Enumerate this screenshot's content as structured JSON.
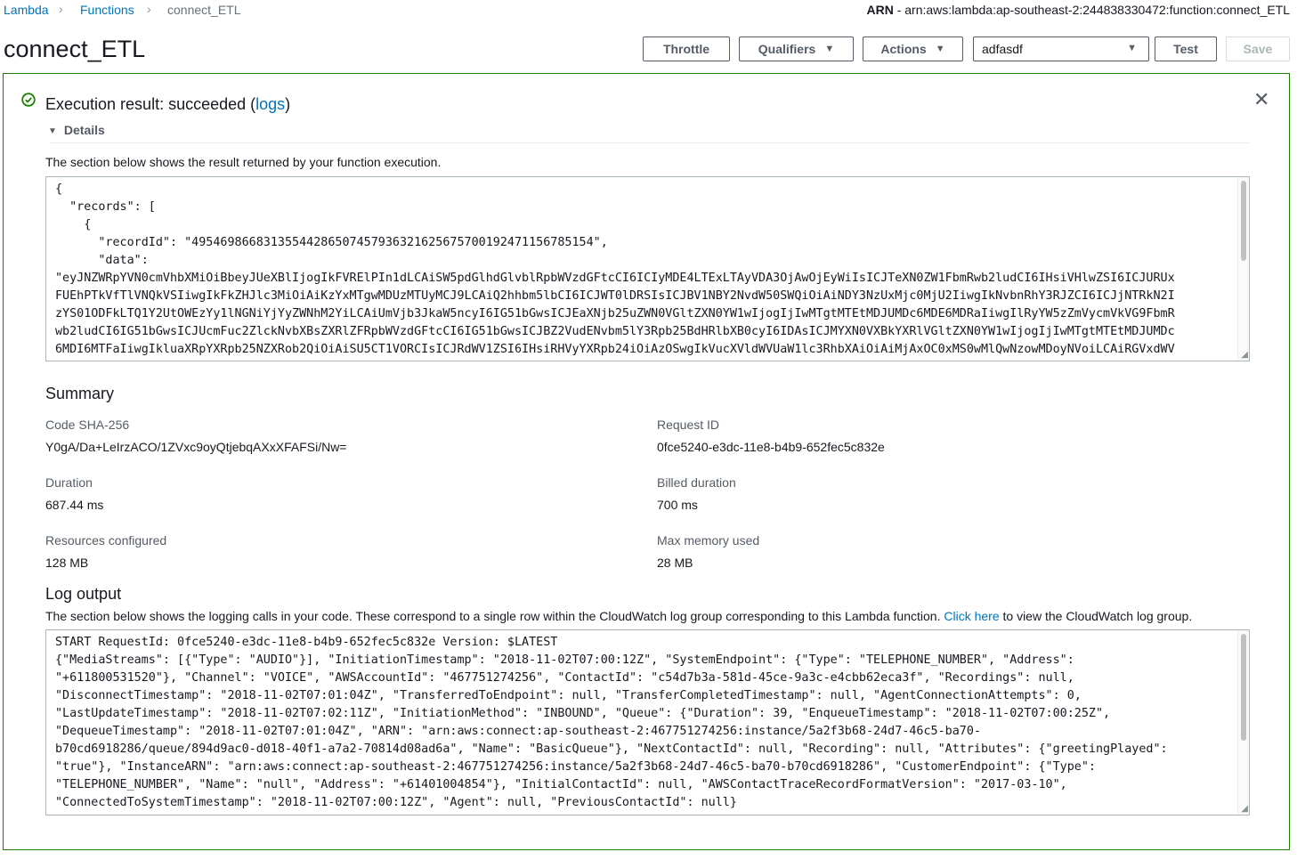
{
  "breadcrumb": {
    "lambda": "Lambda",
    "functions": "Functions",
    "current": "connect_ETL"
  },
  "arn": {
    "label": "ARN",
    "value": " - arn:aws:lambda:ap-southeast-2:244838330472:function:connect_ETL"
  },
  "page_title": "connect_ETL",
  "toolbar": {
    "throttle": "Throttle",
    "qualifiers": "Qualifiers",
    "actions": "Actions",
    "test_event": "adfasdf",
    "test": "Test",
    "save": "Save"
  },
  "result": {
    "prefix": "Execution result: succeeded (",
    "logs_link": "logs",
    "suffix": ")",
    "details": "Details",
    "description": "The section below shows the result returned by your function execution.",
    "output_lines": [
      "{",
      "  \"records\": [",
      "    {",
      "      \"recordId\": \"49546986683135544286507457936321625675700192471156785154\",",
      "      \"data\":",
      "\"eyJNZWRpYVN0cmVhbXMiOiBbeyJUeXBlIjogIkFVRElPIn1dLCAiSW5pdGlhdGlvblRpbWVzdGFtcCI6ICIyMDE4LTExLTAyVDA3OjAwOjEyWiIsICJTeXN0ZW1FbmRwb2ludCI6IHsiVHlwZSI6ICJURUx",
      "FUEhPTkVfTlVNQkVSIiwgIkFkZHJlc3MiOiAiKzYxMTgwMDUzMTUyMCJ9LCAiQ2hhbm5lbCI6ICJWT0lDRSIsICJBV1NBY2NvdW50SWQiOiAiNDY3NzUxMjc0MjU2IiwgIkNvbnRhY3RJZCI6ICJjNTRkN2I",
      "zYS01ODFkLTQ1Y2UtOWEzYy1lNGNiYjYyZWNhM2YiLCAiUmVjb3JkaW5ncyI6IG51bGwsICJEaXNjb25uZWN0VGltZXN0YW1wIjogIjIwMTgtMTEtMDJUMDc6MDE6MDRaIiwgIlRyYW5zZmVycmVkVG9FbmR",
      "wb2ludCI6IG51bGwsICJUcmFuc2ZlckNvbXBsZXRlZFRpbWVzdGFtcCI6IG51bGwsICJBZ2VudENvbm5lY3Rpb25BdHRlbXB0cyI6IDAsICJMYXN0VXBkYXRlVGltZXN0YW1wIjogIjIwMTgtMTEtMDJUMDc",
      "6MDI6MTFaIiwgIkluaXRpYXRpb25NZXRob2QiOiAiSU5CT1VORCIsICJRdWV1ZSI6IHsiRHVyYXRpb24iOiAzOSwgIkVucXVldWVUaW1lc3RhbXAiOiAiMjAxOC0xMS0wMlQwNzowMDoyNVoiLCAiRGVxdWV"
    ]
  },
  "summary": {
    "heading": "Summary",
    "code_sha_label": "Code SHA-256",
    "code_sha_value": "Y0gA/Da+LeIrzACO/1ZVxc9oyQtjebqAXxXFAFSi/Nw=",
    "request_id_label": "Request ID",
    "request_id_value": "0fce5240-e3dc-11e8-b4b9-652fec5c832e",
    "duration_label": "Duration",
    "duration_value": "687.44 ms",
    "billed_label": "Billed duration",
    "billed_value": "700 ms",
    "resources_label": "Resources configured",
    "resources_value": "128 MB",
    "maxmem_label": "Max memory used",
    "maxmem_value": "28 MB"
  },
  "log": {
    "heading": "Log output",
    "desc_prefix": "The section below shows the logging calls in your code. These correspond to a single row within the CloudWatch log group corresponding to this Lambda function. ",
    "link": "Click here",
    "desc_suffix": " to view the CloudWatch log group.",
    "lines": [
      "START RequestId: 0fce5240-e3dc-11e8-b4b9-652fec5c832e Version: $LATEST",
      "{\"MediaStreams\": [{\"Type\": \"AUDIO\"}], \"InitiationTimestamp\": \"2018-11-02T07:00:12Z\", \"SystemEndpoint\": {\"Type\": \"TELEPHONE_NUMBER\", \"Address\":",
      "\"+611800531520\"}, \"Channel\": \"VOICE\", \"AWSAccountId\": \"467751274256\", \"ContactId\": \"c54d7b3a-581d-45ce-9a3c-e4cbb62eca3f\", \"Recordings\": null,",
      "\"DisconnectTimestamp\": \"2018-11-02T07:01:04Z\", \"TransferredToEndpoint\": null, \"TransferCompletedTimestamp\": null, \"AgentConnectionAttempts\": 0,",
      "\"LastUpdateTimestamp\": \"2018-11-02T07:02:11Z\", \"InitiationMethod\": \"INBOUND\", \"Queue\": {\"Duration\": 39, \"EnqueueTimestamp\": \"2018-11-02T07:00:25Z\",",
      "\"DequeueTimestamp\": \"2018-11-02T07:01:04Z\", \"ARN\": \"arn:aws:connect:ap-southeast-2:467751274256:instance/5a2f3b68-24d7-46c5-ba70-",
      "b70cd6918286/queue/894d9ac0-d018-40f1-a7a2-70814d08ad6a\", \"Name\": \"BasicQueue\"}, \"NextContactId\": null, \"Recording\": null, \"Attributes\": {\"greetingPlayed\":",
      "\"true\"}, \"InstanceARN\": \"arn:aws:connect:ap-southeast-2:467751274256:instance/5a2f3b68-24d7-46c5-ba70-b70cd6918286\", \"CustomerEndpoint\": {\"Type\":",
      "\"TELEPHONE_NUMBER\", \"Name\": \"null\", \"Address\": \"+61401004854\"}, \"InitialContactId\": null, \"AWSContactTraceRecordFormatVersion\": \"2017-03-10\",",
      "\"ConnectedToSystemTimestamp\": \"2018-11-02T07:00:12Z\", \"Agent\": null, \"PreviousContactId\": null}"
    ]
  },
  "colors": {
    "success": "#1d8102",
    "link": "#0073bb"
  }
}
